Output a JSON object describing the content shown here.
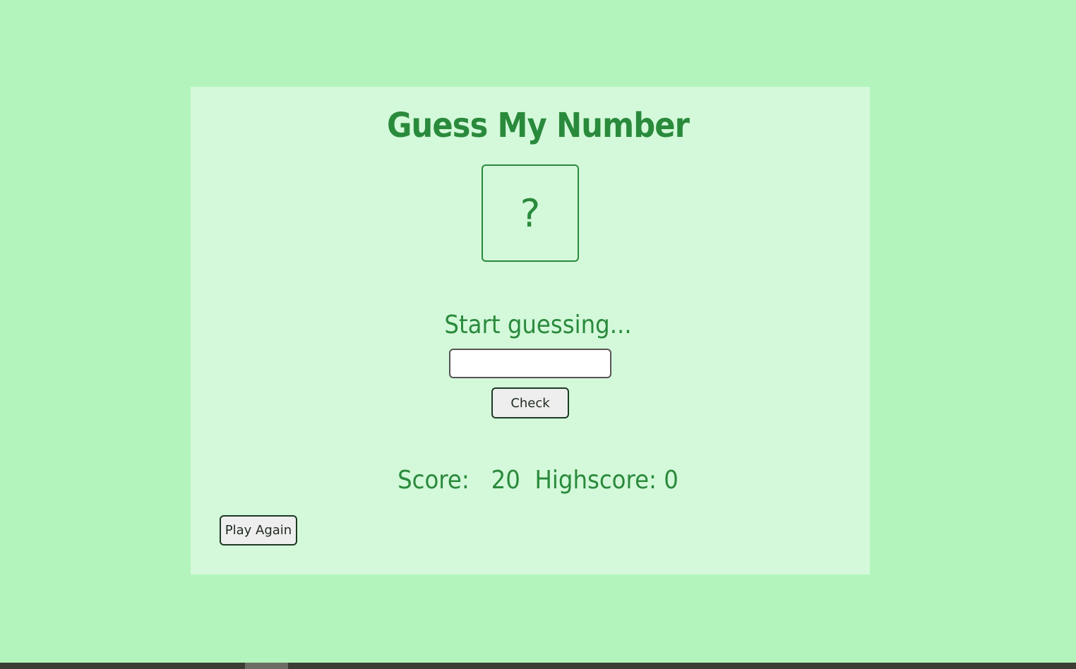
{
  "game": {
    "title": "Guess My Number",
    "secret_display": "?",
    "message": "Start guessing...",
    "guess_input": {
      "value": "",
      "placeholder": ""
    },
    "check_label": "Check",
    "score_label": "Score:",
    "score_value": "20",
    "highscore_label": "Highscore:",
    "highscore_value": "0",
    "play_again_label": "Play Again"
  },
  "colors": {
    "page_background": "#b3f4bd",
    "card_background": "#d4f9da",
    "accent_green": "#2a8a3c",
    "button_background": "#eeeeee"
  }
}
